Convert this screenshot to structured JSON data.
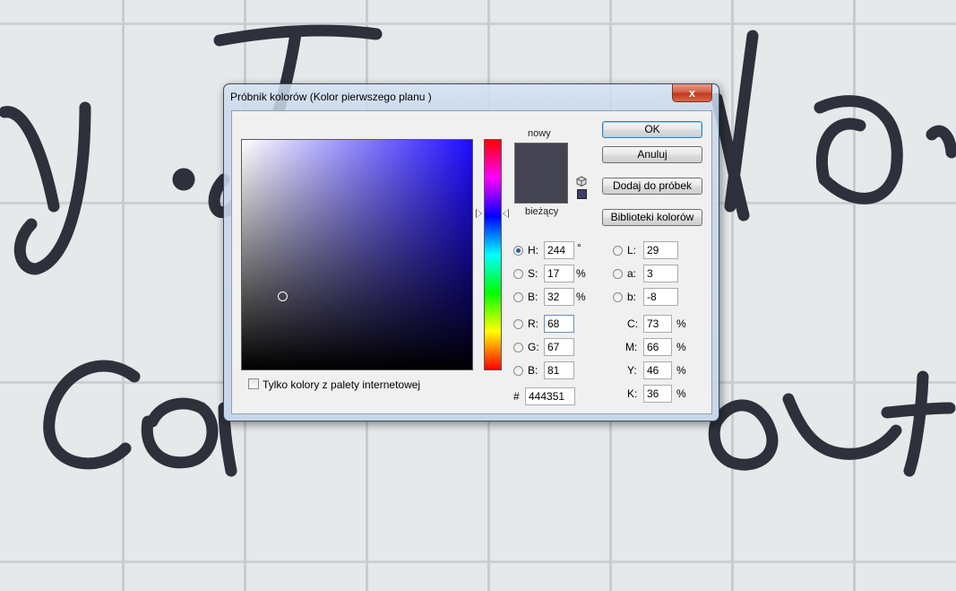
{
  "dialog": {
    "title": "Próbnik kolorów (Kolor pierwszego planu )",
    "close_glyph": "x"
  },
  "preview": {
    "new_label": "nowy",
    "current_label": "bieżący",
    "new_color": "#444351",
    "current_color": "#444351",
    "mini_swatch_color": "#3e3f6a"
  },
  "buttons": {
    "ok": "OK",
    "cancel": "Anuluj",
    "add_to_swatches": "Dodaj do próbek",
    "color_libraries": "Biblioteki kolorów"
  },
  "hsb": {
    "h": {
      "label": "H:",
      "value": "244",
      "unit": "°"
    },
    "s": {
      "label": "S:",
      "value": "17",
      "unit": "%"
    },
    "b": {
      "label": "B:",
      "value": "32",
      "unit": "%"
    }
  },
  "rgb": {
    "r": {
      "label": "R:",
      "value": "68"
    },
    "g": {
      "label": "G:",
      "value": "67"
    },
    "b": {
      "label": "B:",
      "value": "81"
    }
  },
  "lab": {
    "l": {
      "label": "L:",
      "value": "29"
    },
    "a": {
      "label": "a:",
      "value": "3"
    },
    "b": {
      "label": "b:",
      "value": "-8"
    }
  },
  "cmyk": {
    "c": {
      "label": "C:",
      "value": "73",
      "unit": "%"
    },
    "m": {
      "label": "M:",
      "value": "66",
      "unit": "%"
    },
    "y": {
      "label": "Y:",
      "value": "46",
      "unit": "%"
    },
    "k": {
      "label": "K:",
      "value": "36",
      "unit": "%"
    }
  },
  "hex": {
    "label": "#",
    "value": "444351"
  },
  "web_only": {
    "label": "Tylko kolory z palety internetowej",
    "checked": false
  },
  "colors": {
    "ok_border": "#3c7fb1",
    "ink": "#2a2d38"
  }
}
